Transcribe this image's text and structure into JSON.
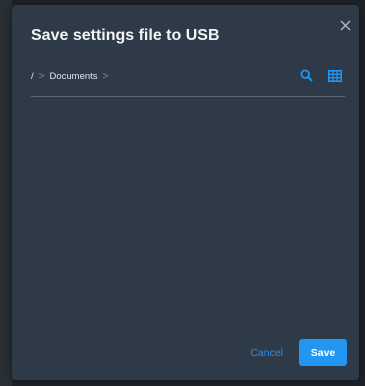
{
  "dialog": {
    "title": "Save settings file to USB",
    "close_icon": "close-icon"
  },
  "breadcrumb": {
    "root": "/",
    "items": [
      {
        "label": "Documents"
      }
    ],
    "separator": ">"
  },
  "toolbar": {
    "search_icon": "search-icon",
    "grid_view_icon": "grid-view-icon"
  },
  "footer": {
    "cancel_label": "Cancel",
    "save_label": "Save"
  },
  "colors": {
    "accent": "#2196f3",
    "dialog_bg": "#2e3a47",
    "backdrop": "#1f2329"
  }
}
